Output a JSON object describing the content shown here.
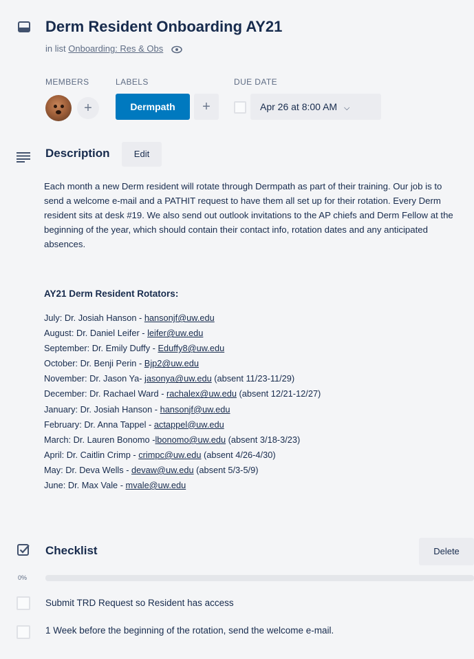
{
  "card": {
    "title": "Derm Resident Onboarding AY21",
    "in_list_prefix": "in list",
    "list_name": "Onboarding: Res & Obs"
  },
  "members": {
    "label": "MEMBERS",
    "add": "+"
  },
  "labels": {
    "label": "LABELS",
    "chip": "Dermpath",
    "chip_color": "#0079bf",
    "add": "+"
  },
  "due_date": {
    "label": "DUE DATE",
    "value": "Apr 26 at 8:00 AM",
    "completed": false
  },
  "description": {
    "title": "Description",
    "edit": "Edit",
    "paragraph": "Each month a new Derm resident will rotate through Dermpath as part of their training. Our job is to send a welcome e-mail and a PATHIT request to have them all set up for their rotation. Every Derm resident sits at desk #19. We also send out outlook invitations to the AP chiefs and Derm Fellow at the beginning of the year, which should contain their contact info, rotation dates and any anticipated absences.",
    "rotators_heading": "AY21 Derm Resident Rotators:",
    "rotators": [
      {
        "prefix": "July: Dr. Josiah Hanson - ",
        "email": "hansonjf@uw.edu",
        "suffix": ""
      },
      {
        "prefix": "August: Dr. Daniel Leifer - ",
        "email": "leifer@uw.edu",
        "suffix": ""
      },
      {
        "prefix": "September: Dr. Emily Duffy - ",
        "email": "Eduffy8@uw.edu",
        "suffix": ""
      },
      {
        "prefix": "October: Dr. Benji Perin - ",
        "email": "Bjp2@uw.edu",
        "suffix": ""
      },
      {
        "prefix": "November: Dr. Jason Ya- ",
        "email": "jasonya@uw.edu",
        "suffix": " (absent 11/23-11/29)"
      },
      {
        "prefix": "December: Dr. Rachael Ward - ",
        "email": "rachalex@uw.edu",
        "suffix": " (absent 12/21-12/27)"
      },
      {
        "prefix": "January: Dr. Josiah Hanson - ",
        "email": "hansonjf@uw.edu",
        "suffix": ""
      },
      {
        "prefix": "February: Dr. Anna Tappel - ",
        "email": "actappel@uw.edu",
        "suffix": ""
      },
      {
        "prefix": "March: Dr. Lauren Bonomo -",
        "email": "lbonomo@uw.edu",
        "suffix": " (absent 3/18-3/23)"
      },
      {
        "prefix": "April: Dr. Caitlin Crimp - ",
        "email": "crimpc@uw.edu",
        "suffix": " (absent 4/26-4/30)"
      },
      {
        "prefix": "May: Dr. Deva Wells - ",
        "email": "devaw@uw.edu",
        "suffix": " (absent 5/3-5/9)"
      },
      {
        "prefix": "June: Dr. Max Vale - ",
        "email": "mvale@uw.edu",
        "suffix": ""
      }
    ]
  },
  "checklist": {
    "title": "Checklist",
    "delete": "Delete",
    "progress_text": "0%",
    "progress": 0,
    "items": [
      {
        "text": "Submit TRD Request so Resident has access",
        "checked": false
      },
      {
        "text": "1 Week before the beginning of the rotation, send the welcome e-mail.",
        "checked": false
      }
    ]
  }
}
